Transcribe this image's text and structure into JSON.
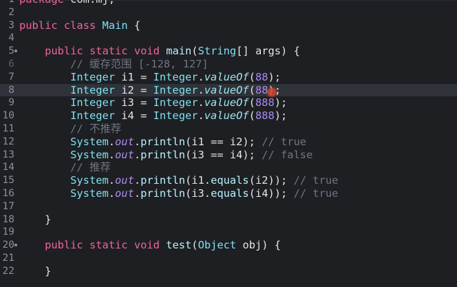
{
  "lines": [
    {
      "n": "1",
      "tokens": [
        [
          "kw",
          "package"
        ],
        [
          "pl",
          " com.mj;"
        ]
      ]
    },
    {
      "n": "2",
      "tokens": []
    },
    {
      "n": "3",
      "tokens": [
        [
          "kw",
          "public"
        ],
        [
          "pl",
          " "
        ],
        [
          "kw",
          "class"
        ],
        [
          "pl",
          " "
        ],
        [
          "ty",
          "Main"
        ],
        [
          "pl",
          " {"
        ]
      ]
    },
    {
      "n": "4",
      "tokens": []
    },
    {
      "n": "5",
      "fold": true,
      "tokens": [
        [
          "pl",
          "    "
        ],
        [
          "kw",
          "public"
        ],
        [
          "pl",
          " "
        ],
        [
          "kw",
          "static"
        ],
        [
          "pl",
          " "
        ],
        [
          "kw",
          "void"
        ],
        [
          "pl",
          " "
        ],
        [
          "mt",
          "main"
        ],
        [
          "pl",
          "("
        ],
        [
          "ty",
          "String"
        ],
        [
          "pl",
          "[] args) {"
        ]
      ]
    },
    {
      "n": "6",
      "dim": true,
      "tokens": [
        [
          "pl",
          "        "
        ],
        [
          "cm",
          "// 缓存范围 [-128, 127]"
        ]
      ]
    },
    {
      "n": "7",
      "tokens": [
        [
          "pl",
          "        "
        ],
        [
          "ty",
          "Integer"
        ],
        [
          "pl",
          " i1 = "
        ],
        [
          "ty",
          "Integer"
        ],
        [
          "pl",
          "."
        ],
        [
          "st",
          "valueOf"
        ],
        [
          "pl",
          "("
        ],
        [
          "nu",
          "88"
        ],
        [
          "pl",
          ");"
        ]
      ]
    },
    {
      "n": "8",
      "current": true,
      "tokens": [
        [
          "pl",
          "        "
        ],
        [
          "ty",
          "Integer"
        ],
        [
          "pl",
          " i2 = "
        ],
        [
          "ty",
          "Integer"
        ],
        [
          "pl",
          "."
        ],
        [
          "st",
          "valueOf"
        ],
        [
          "pl",
          "("
        ],
        [
          "nu",
          "88"
        ],
        [
          "pl",
          ");"
        ]
      ]
    },
    {
      "n": "9",
      "tokens": [
        [
          "pl",
          "        "
        ],
        [
          "ty",
          "Integer"
        ],
        [
          "pl",
          " i3 = "
        ],
        [
          "ty",
          "Integer"
        ],
        [
          "pl",
          "."
        ],
        [
          "st",
          "valueOf"
        ],
        [
          "pl",
          "("
        ],
        [
          "nu",
          "888"
        ],
        [
          "pl",
          ");"
        ]
      ]
    },
    {
      "n": "10",
      "tokens": [
        [
          "pl",
          "        "
        ],
        [
          "ty",
          "Integer"
        ],
        [
          "pl",
          " i4 = "
        ],
        [
          "ty",
          "Integer"
        ],
        [
          "pl",
          "."
        ],
        [
          "st",
          "valueOf"
        ],
        [
          "pl",
          "("
        ],
        [
          "nu",
          "888"
        ],
        [
          "pl",
          ");"
        ]
      ]
    },
    {
      "n": "11",
      "tokens": [
        [
          "pl",
          "        "
        ],
        [
          "cm",
          "// 不推荐"
        ]
      ]
    },
    {
      "n": "12",
      "tokens": [
        [
          "pl",
          "        "
        ],
        [
          "ty",
          "System"
        ],
        [
          "pl",
          "."
        ],
        [
          "fi",
          "out"
        ],
        [
          "pl",
          "."
        ],
        [
          "mt",
          "println"
        ],
        [
          "pl",
          "(i1 == i2); "
        ],
        [
          "cm",
          "// true"
        ]
      ]
    },
    {
      "n": "13",
      "tokens": [
        [
          "pl",
          "        "
        ],
        [
          "ty",
          "System"
        ],
        [
          "pl",
          "."
        ],
        [
          "fi",
          "out"
        ],
        [
          "pl",
          "."
        ],
        [
          "mt",
          "println"
        ],
        [
          "pl",
          "(i3 == i4); "
        ],
        [
          "cm",
          "// false"
        ]
      ]
    },
    {
      "n": "14",
      "tokens": [
        [
          "pl",
          "        "
        ],
        [
          "cm",
          "// 推荐"
        ]
      ]
    },
    {
      "n": "15",
      "tokens": [
        [
          "pl",
          "        "
        ],
        [
          "ty",
          "System"
        ],
        [
          "pl",
          "."
        ],
        [
          "fi",
          "out"
        ],
        [
          "pl",
          "."
        ],
        [
          "mt",
          "println"
        ],
        [
          "pl",
          "(i1."
        ],
        [
          "mt",
          "equals"
        ],
        [
          "pl",
          "(i2)); "
        ],
        [
          "cm",
          "// true"
        ]
      ]
    },
    {
      "n": "16",
      "tokens": [
        [
          "pl",
          "        "
        ],
        [
          "ty",
          "System"
        ],
        [
          "pl",
          "."
        ],
        [
          "fi",
          "out"
        ],
        [
          "pl",
          "."
        ],
        [
          "mt",
          "println"
        ],
        [
          "pl",
          "(i3."
        ],
        [
          "mt",
          "equals"
        ],
        [
          "pl",
          "(i4)); "
        ],
        [
          "cm",
          "// true"
        ]
      ]
    },
    {
      "n": "17",
      "tokens": []
    },
    {
      "n": "18",
      "tokens": [
        [
          "pl",
          "    }"
        ]
      ]
    },
    {
      "n": "19",
      "tokens": []
    },
    {
      "n": "20",
      "fold": true,
      "tokens": [
        [
          "pl",
          "    "
        ],
        [
          "kw",
          "public"
        ],
        [
          "pl",
          " "
        ],
        [
          "kw",
          "static"
        ],
        [
          "pl",
          " "
        ],
        [
          "kw",
          "void"
        ],
        [
          "pl",
          " "
        ],
        [
          "mt",
          "test"
        ],
        [
          "pl",
          "("
        ],
        [
          "ty",
          "Object"
        ],
        [
          "pl",
          " obj) {"
        ]
      ]
    },
    {
      "n": "21",
      "tokens": []
    },
    {
      "n": "22",
      "tokens": [
        [
          "pl",
          "    }"
        ]
      ]
    }
  ]
}
